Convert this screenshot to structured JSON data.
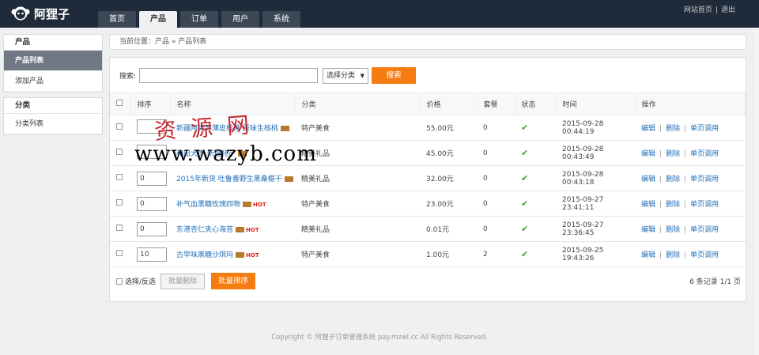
{
  "app": {
    "logo_text": "阿狸子"
  },
  "nav": {
    "tabs": [
      {
        "label": "首页"
      },
      {
        "label": "产品"
      },
      {
        "label": "订单"
      },
      {
        "label": "用户"
      },
      {
        "label": "系统"
      }
    ],
    "active_tab": "产品",
    "links": {
      "home": "网站首页",
      "logout": "退出"
    }
  },
  "sidebar": {
    "groups": [
      {
        "title": "产品",
        "items": [
          {
            "label": "产品列表",
            "active": true
          },
          {
            "label": "添加产品",
            "active": false
          }
        ]
      },
      {
        "title": "分类",
        "items": [
          {
            "label": "分类列表",
            "active": false
          }
        ]
      }
    ]
  },
  "breadcrumb": {
    "text": "当前位置：产品 » 产品列表"
  },
  "search": {
    "label": "搜索:",
    "value": "",
    "category_select": "选择分类",
    "button": "搜索"
  },
  "table": {
    "headers": [
      "排序",
      "名称",
      "分类",
      "价格",
      "套餐",
      "状态",
      "时间",
      "操作"
    ],
    "rows": [
      {
        "sort": "",
        "name": "新疆阿克苏薄皮核桃 原味生核桃",
        "tag": true,
        "hot": false,
        "category": "特产美食",
        "price": "55.00元",
        "package": "0",
        "time": "2015-09-28 00:44:19"
      },
      {
        "sort": "",
        "name": "和田大枣 新疆特产",
        "tag": true,
        "hot": false,
        "category": "精美礼品",
        "price": "45.00元",
        "package": "0",
        "time": "2015-09-28 00:43:49"
      },
      {
        "sort": "0",
        "name": "2015年新货 吐鲁番野生黑桑椹干",
        "tag": true,
        "hot": false,
        "category": "精美礼品",
        "price": "32.00元",
        "package": "0",
        "time": "2015-09-28 00:43:18"
      },
      {
        "sort": "0",
        "name": "补气血黑糖玫瑰四物",
        "tag": true,
        "hot": true,
        "category": "特产美食",
        "price": "23.00元",
        "package": "0",
        "time": "2015-09-27 23:41:11"
      },
      {
        "sort": "0",
        "name": "东港杏仁夹心海苔",
        "tag": true,
        "hot": true,
        "category": "精美礼品",
        "price": "0.01元",
        "package": "0",
        "time": "2015-09-27 23:36:45"
      },
      {
        "sort": "10",
        "name": "古早味黑糖沙琪玛",
        "tag": true,
        "hot": true,
        "category": "特产美食",
        "price": "1.00元",
        "package": "2",
        "time": "2015-09-25 19:43:26"
      }
    ],
    "status_icon": "check-icon",
    "ops": {
      "edit": "编辑",
      "delete": "删除",
      "page_call": "单页调用"
    },
    "hot_label": "HOT"
  },
  "bulk": {
    "select_all": "选择/反选",
    "bulk_delete": "批量删除",
    "bulk_sort": "批量排序"
  },
  "pager": {
    "text": "6 条记录 1/1 页"
  },
  "footer": {
    "text": "Copyright © 阿狸子订单管理系统 pay.mzwl.cc  All Rights Reserved."
  },
  "watermark": {
    "line1": "资源网",
    "line2": "www.wazyb.com"
  }
}
